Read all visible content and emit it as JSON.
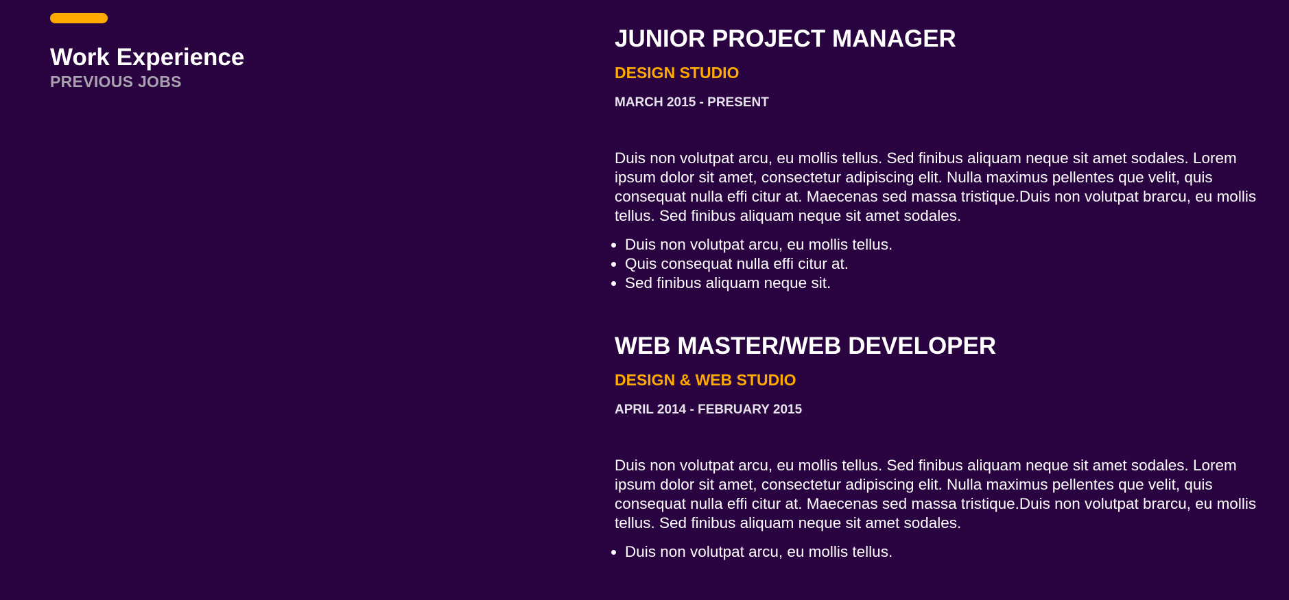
{
  "colors": {
    "background": "#2a0440",
    "accent": "#ffaa00",
    "subtitle": "#a9a3b0",
    "text": "#ffffff"
  },
  "section": {
    "title": "Work Experience",
    "subtitle": "PREVIOUS JOBS"
  },
  "jobs": [
    {
      "title": "JUNIOR PROJECT MANAGER",
      "company": "DESIGN STUDIO",
      "dates": "MARCH 2015 - PRESENT",
      "description": "Duis non volutpat arcu, eu mollis tellus. Sed finibus aliquam neque sit amet sodales. Lorem ipsum dolor sit amet, consectetur adipiscing elit. Nulla maximus pellentes que velit, quis consequat nulla effi citur at. Maecenas sed massa tristique.Duis non volutpat brarcu, eu mollis tellus. Sed finibus aliquam neque sit amet sodales.",
      "bullets": [
        "Duis non volutpat arcu, eu mollis tellus.",
        "Quis consequat nulla effi citur at.",
        "Sed finibus aliquam neque sit."
      ]
    },
    {
      "title": "WEB MASTER/WEB DEVELOPER",
      "company": "DESIGN & WEB STUDIO",
      "dates": "APRIL 2014 - FEBRUARY 2015",
      "description": "Duis non volutpat arcu, eu mollis tellus. Sed finibus aliquam neque sit amet sodales. Lorem ipsum dolor sit amet, consectetur adipiscing elit. Nulla maximus pellentes que velit, quis consequat nulla effi citur at. Maecenas sed massa tristique.Duis non volutpat brarcu, eu mollis tellus. Sed finibus aliquam neque sit amet sodales.",
      "bullets": [
        "Duis non volutpat arcu, eu mollis tellus."
      ]
    }
  ]
}
